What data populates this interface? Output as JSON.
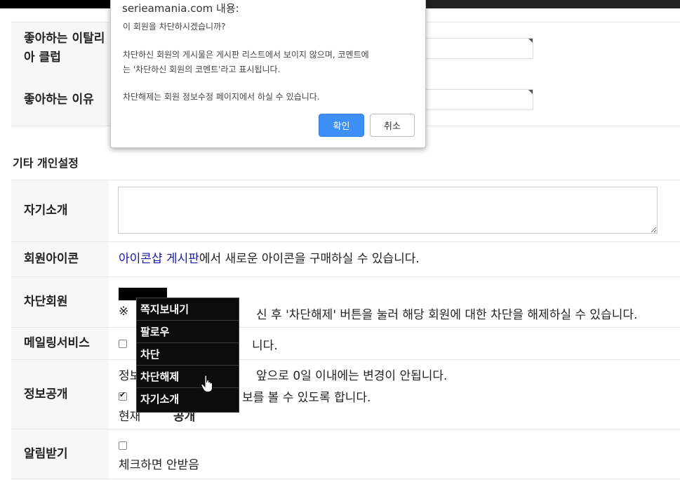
{
  "dialog": {
    "title": "serieamania.com 내용:",
    "line1": "이 회원을 차단하시겠습니까?",
    "line2": "차단하신 회원의 게시물은 게시판 리스트에서 보이지 않으며, 코멘트에",
    "line3": "는 '차단하신 회원의 코멘트'라고 표시됩니다.",
    "line4": "차단해제는 회원 정보수정 페이지에서 하실 수 있습니다.",
    "ok_label": "확인",
    "cancel_label": "취소"
  },
  "form": {
    "fav_club_label": "좋아하는 이탈리아 클럽",
    "fav_reason_label": "좋아하는 이유",
    "section_title": "기타 개인설정",
    "intro_label": "자기소개",
    "icon_label": "회원아이콘",
    "icon_link": "아이콘샵 게시판",
    "icon_text": "에서 새로운 아이콘을 구매하실 수 있습니다.",
    "block_label": "차단회원",
    "block_note_prefix": "※",
    "block_note": "신 후 '차단해제' 버튼을 눌러 해당 회원에 대한 차단을 해제하실 수 있습니다.",
    "mail_label": "메일링서비스",
    "mail_text": "니다.",
    "info_label": "정보공개",
    "info_line1_a": "정보",
    "info_line1_b": "앞으로 0일 이내에는 변경이 안됩니다.",
    "info_line2": "보를 볼 수 있도록 합니다.",
    "info_line3_a": "현재",
    "info_line3_b": "공개",
    "notify_label": "알림받기",
    "notify_text": "체크하면 안받음"
  },
  "context_menu": {
    "items": [
      "쪽지보내기",
      "팔로우",
      "차단",
      "차단해제",
      "자기소개"
    ]
  }
}
